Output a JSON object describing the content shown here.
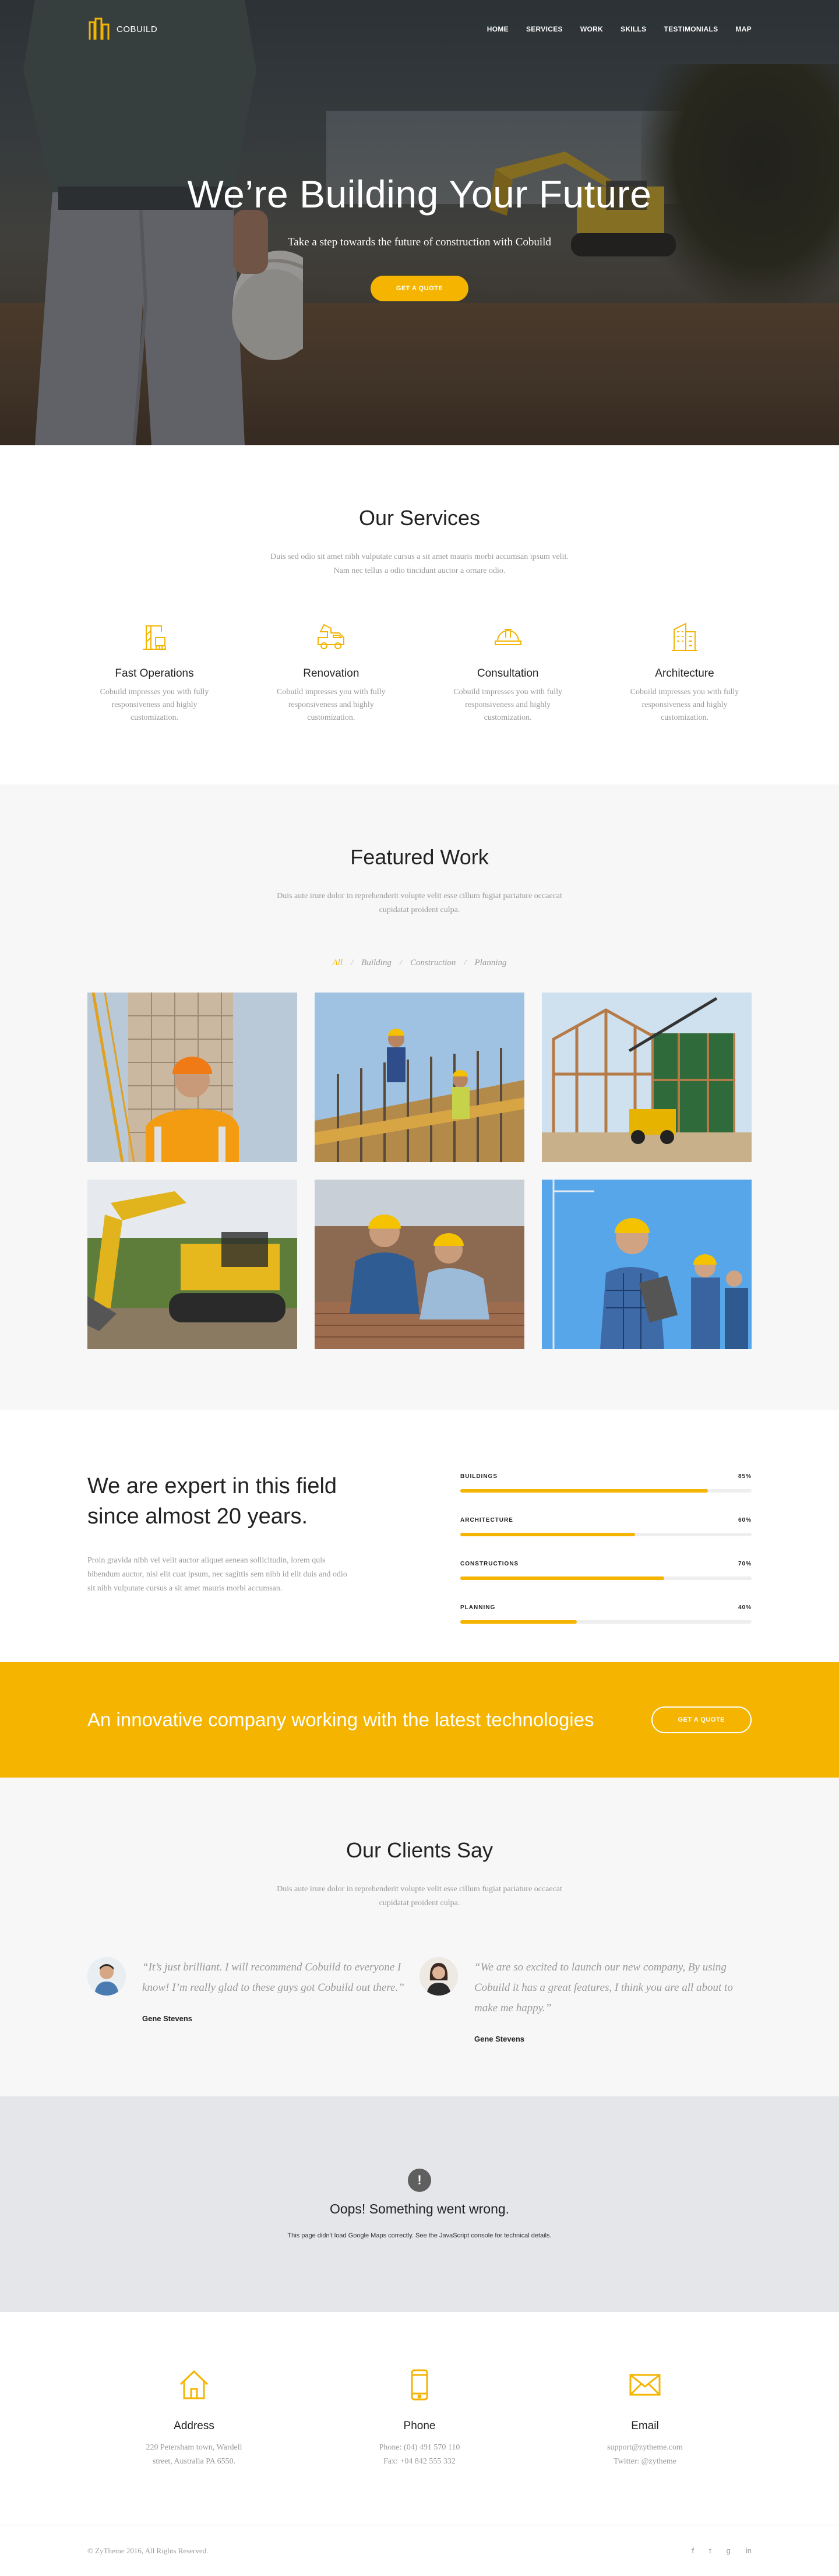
{
  "brand": {
    "name": "COBUILD"
  },
  "nav": [
    "HOME",
    "SERVICES",
    "WORK",
    "SKILLS",
    "TESTIMONIALS",
    "MAP"
  ],
  "hero": {
    "title": "We’re Building Your Future",
    "subtitle": "Take a step towards the future of construction with Cobuild",
    "button": "GET A QUOTE"
  },
  "services": {
    "title": "Our Services",
    "description": "Duis sed odio sit amet nibh vulputate cursus a sit amet mauris morbi accumsan ipsum velit. Nam nec tellus a odio tincidunt auctor a ornare odio.",
    "items": [
      {
        "title": "Fast Operations",
        "text": "Cobuild impresses you with fully responsiveness and highly customization.",
        "icon": "crane-icon"
      },
      {
        "title": "Renovation",
        "text": "Cobuild impresses you with fully responsiveness and highly customization.",
        "icon": "truck-icon"
      },
      {
        "title": "Consultation",
        "text": "Cobuild impresses you with fully responsiveness and highly customization.",
        "icon": "helmet-icon"
      },
      {
        "title": "Architecture",
        "text": "Cobuild impresses you with fully responsiveness and highly customization.",
        "icon": "building-icon"
      }
    ]
  },
  "work": {
    "title": "Featured Work",
    "description": "Duis aute irure dolor in reprehenderit volupte velit esse cillum fugiat pariature occaecat cupidatat proident culpa.",
    "filters": [
      "All",
      "Building",
      "Construction",
      "Planning"
    ],
    "active_filter": "All"
  },
  "skills": {
    "title": "We are expert in this field since almost 20 years.",
    "text": "Proin gravida nibh vel velit auctor aliquet aenean sollicitudin, lorem quis bibendum auctor, nisi elit cuat ipsum, nec sagittis sem nibh id elit duis and odio sit nibh vulputate cursus a sit amet mauris morbi accumsan.",
    "bars": [
      {
        "label": "BUILDINGS",
        "value": 85,
        "display": "85%"
      },
      {
        "label": "ARCHITECTURE",
        "value": 60,
        "display": "60%"
      },
      {
        "label": "CONSTRUCTIONS",
        "value": 70,
        "display": "70%"
      },
      {
        "label": "PLANNING",
        "value": 40,
        "display": "40%"
      }
    ]
  },
  "cta": {
    "text": "An innovative company working with the latest technologies",
    "button": "GET A QUOTE"
  },
  "clients": {
    "title": "Our Clients Say",
    "description": "Duis aute irure dolor in reprehenderit volupte velit esse cillum fugiat pariature occaecat cupidatat proident culpa.",
    "testimonials": [
      {
        "quote": "“It’s just brilliant. I will recommend Cobuild to everyone I know! I’m really glad to these guys got Cobuild out there.”",
        "author": "Gene Stevens"
      },
      {
        "quote": "“We are so excited to launch our new company, By using Cobuild it has a great features, I think you are all about to make me happy.”",
        "author": "Gene Stevens"
      }
    ]
  },
  "map": {
    "icon": "!",
    "title": "Oops! Something went wrong.",
    "text": "This page didn't load Google Maps correctly. See the JavaScript console for technical details."
  },
  "contact": [
    {
      "title": "Address",
      "line1": "220 Petersham town, Wardell",
      "line2": "street, Australia PA 6550.",
      "icon": "home-icon"
    },
    {
      "title": "Phone",
      "line1": "Phone: (04) 491 570 110",
      "line2": "Fax: +04 842 555 332",
      "icon": "phone-icon"
    },
    {
      "title": "Email",
      "line1": "support@zytheme.com",
      "line2": "Twitter: @zytheme",
      "icon": "envelope-icon"
    }
  ],
  "footer": {
    "copyright": "© ZyTheme 2016, All Rights Reserved.",
    "socials": [
      "f",
      "t",
      "g",
      "in"
    ]
  },
  "colors": {
    "accent": "#f4b400",
    "text": "#222222",
    "muted": "#999999"
  }
}
